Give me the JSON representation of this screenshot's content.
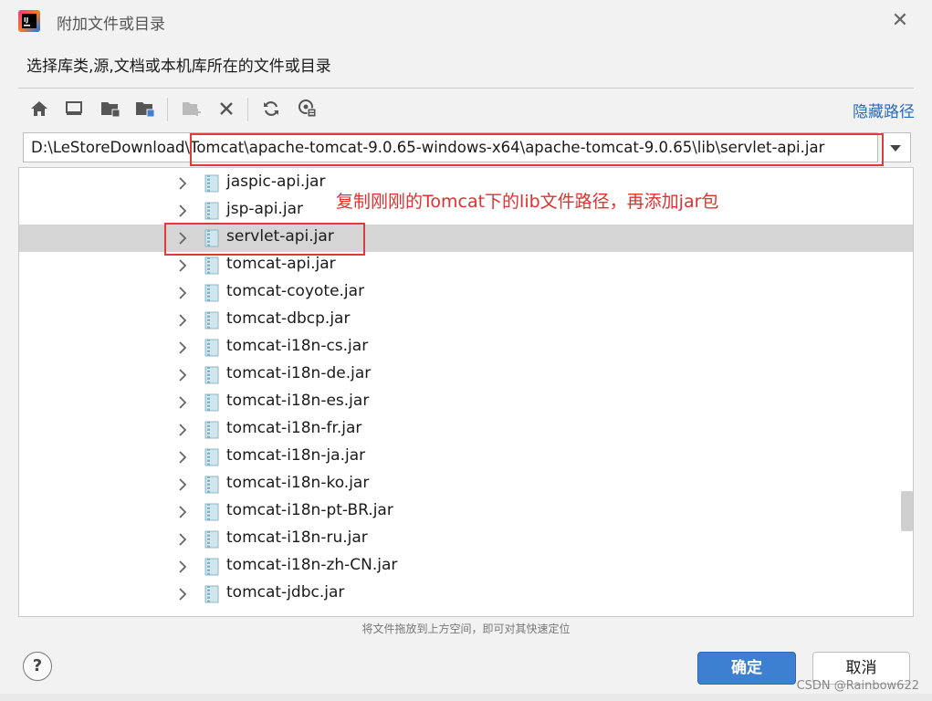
{
  "window": {
    "title": "附加文件或目录",
    "close_icon": "close-icon"
  },
  "subtitle": "选择库类,源,文档或本机库所在的文件或目录",
  "toolbar": {
    "buttons": [
      "home-icon",
      "desktop-icon",
      "project-folder-icon",
      "module-folder-icon",
      "new-folder-icon",
      "delete-icon",
      "refresh-icon",
      "show-hidden-icon"
    ],
    "hide_path_label": "隐藏路径"
  },
  "path": {
    "value": "D:\\LeStoreDownload\\Tomcat\\apache-tomcat-9.0.65-windows-x64\\apache-tomcat-9.0.65\\lib\\servlet-api.jar"
  },
  "tree": {
    "items": [
      {
        "label": "jaspic-api.jar"
      },
      {
        "label": "jsp-api.jar"
      },
      {
        "label": "servlet-api.jar",
        "selected": true
      },
      {
        "label": "tomcat-api.jar"
      },
      {
        "label": "tomcat-coyote.jar"
      },
      {
        "label": "tomcat-dbcp.jar"
      },
      {
        "label": "tomcat-i18n-cs.jar"
      },
      {
        "label": "tomcat-i18n-de.jar"
      },
      {
        "label": "tomcat-i18n-es.jar"
      },
      {
        "label": "tomcat-i18n-fr.jar"
      },
      {
        "label": "tomcat-i18n-ja.jar"
      },
      {
        "label": "tomcat-i18n-ko.jar"
      },
      {
        "label": "tomcat-i18n-pt-BR.jar"
      },
      {
        "label": "tomcat-i18n-ru.jar"
      },
      {
        "label": "tomcat-i18n-zh-CN.jar"
      },
      {
        "label": "tomcat-jdbc.jar"
      }
    ]
  },
  "annotation": "复制刚刚的Tomcat下的lib文件路径，再添加jar包",
  "hint": "将文件拖放到上方空间，即可对其快速定位",
  "buttons": {
    "ok": "确定",
    "cancel": "取消",
    "help": "?"
  },
  "watermark": "CSDN @Rainbow622",
  "colors": {
    "accent": "#3d7fd1",
    "annotation": "#e0302f",
    "link": "#2e6bb8",
    "selection": "#d5d5d5"
  }
}
